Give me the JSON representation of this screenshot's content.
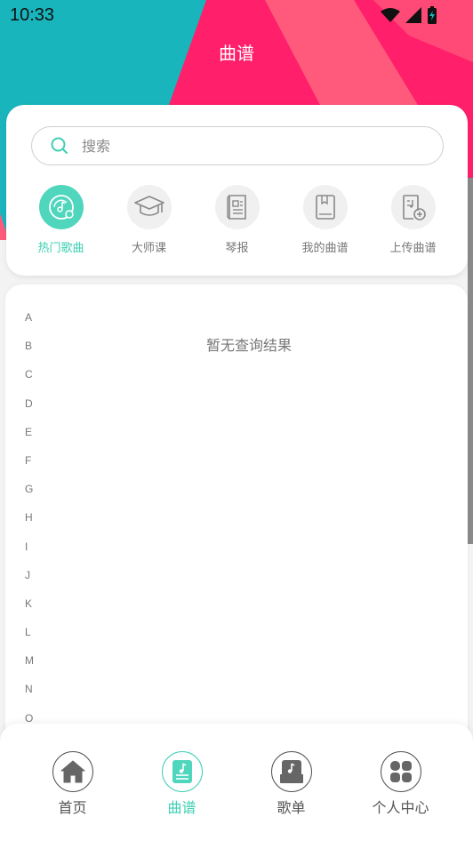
{
  "status_bar": {
    "time": "10:33"
  },
  "header": {
    "title": "曲谱"
  },
  "search": {
    "placeholder": "搜索"
  },
  "categories": [
    {
      "label": "热门歌曲",
      "icon": "hot-songs-icon",
      "active": true
    },
    {
      "label": "大师课",
      "icon": "graduation-cap-icon",
      "active": false
    },
    {
      "label": "琴报",
      "icon": "newspaper-icon",
      "active": false
    },
    {
      "label": "我的曲谱",
      "icon": "bookmark-book-icon",
      "active": false
    },
    {
      "label": "上传曲谱",
      "icon": "upload-score-icon",
      "active": false
    }
  ],
  "index_letters": [
    "A",
    "B",
    "C",
    "D",
    "E",
    "F",
    "G",
    "H",
    "I",
    "J",
    "K",
    "L",
    "M",
    "N",
    "O"
  ],
  "empty_message": "暂无查询结果",
  "bottom_nav": [
    {
      "label": "首页",
      "icon": "home-icon",
      "active": false
    },
    {
      "label": "曲谱",
      "icon": "score-icon",
      "active": true
    },
    {
      "label": "歌单",
      "icon": "playlist-icon",
      "active": false
    },
    {
      "label": "个人中心",
      "icon": "profile-grid-icon",
      "active": false
    }
  ],
  "colors": {
    "accent": "#3ecfb3",
    "header_teal": "#19b5bd",
    "header_pink": "#ff1f6b"
  }
}
